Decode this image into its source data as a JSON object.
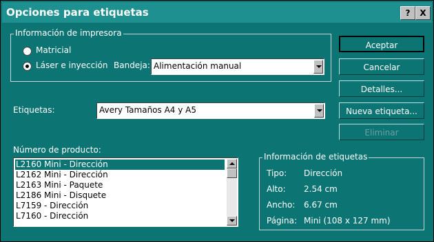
{
  "window": {
    "title": "Opciones para etiquetas",
    "help_label": "?",
    "close_label": "X"
  },
  "printer_info": {
    "legend": "Información de impresora",
    "options": [
      {
        "label": "Matricial",
        "selected": false
      },
      {
        "label": "Láser e inyección",
        "selected": true
      }
    ],
    "tray_label": "Bandeja:",
    "tray_value": "Alimentación manual"
  },
  "labels": {
    "label": "Etiquetas:",
    "value": "Avery Tamaños A4 y A5"
  },
  "product_number": {
    "label": "Número de producto:",
    "items": [
      "L2160 Mini - Dirección",
      "L2162 Mini - Dirección",
      "L2163 Mini - Paquete",
      "L2186 Mini - Disquete",
      "L7159 - Dirección",
      "L7160 - Dirección"
    ],
    "selected_index": 0
  },
  "label_info": {
    "legend": "Información de etiquetas",
    "rows": [
      {
        "key": "Tipo:",
        "value": "Dirección"
      },
      {
        "key": "Alto:",
        "value": "2.54 cm"
      },
      {
        "key": "Ancho:",
        "value": "6.67 cm"
      },
      {
        "key": "Página:",
        "value": "Mini (108 x 127 mm)"
      }
    ]
  },
  "buttons": {
    "accept": "Aceptar",
    "cancel": "Cancelar",
    "details": "Detalles...",
    "new_label": "Nueva etiqueta...",
    "delete": "Eliminar"
  },
  "colors": {
    "background": "#0d7474",
    "titlebar": "#1e9090",
    "selection": "#0d7474"
  }
}
